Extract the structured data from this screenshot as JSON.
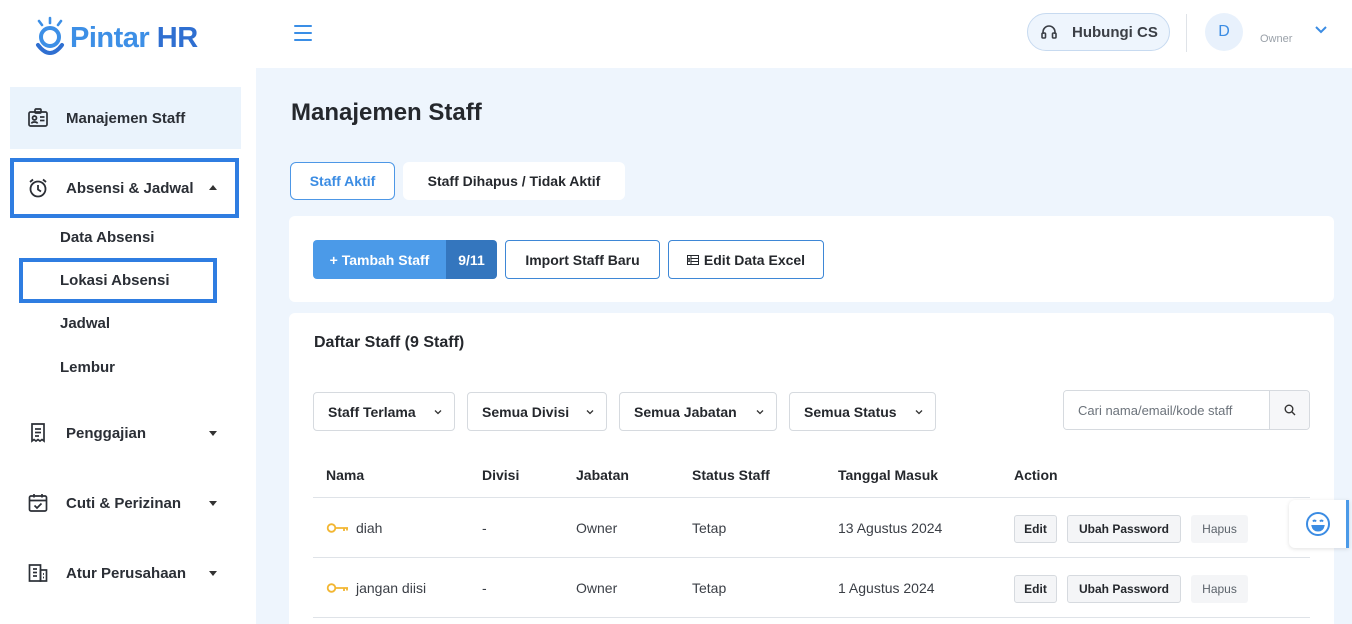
{
  "brand": {
    "logo_text": "Pintar",
    "logo_text_hr": "HR",
    "accent": "#3d8fe6"
  },
  "sidebar": {
    "items": [
      {
        "label": "Manajemen Staff",
        "icon": "id-card-icon"
      },
      {
        "label": "Absensi & Jadwal",
        "icon": "alarm-clock-icon"
      },
      {
        "label": "Penggajian",
        "icon": "receipt-icon"
      },
      {
        "label": "Cuti & Perizinan",
        "icon": "calendar-check-icon"
      },
      {
        "label": "Atur Perusahaan",
        "icon": "building-icon"
      }
    ],
    "submenu": [
      "Data Absensi",
      "Lokasi Absensi",
      "Jadwal",
      "Lembur"
    ]
  },
  "header": {
    "cs_label": "Hubungi CS",
    "avatar_initial": "D",
    "role": "Owner"
  },
  "main": {
    "title": "Manajemen Staff",
    "tabs": [
      "Staff Aktif",
      "Staff Dihapus / Tidak Aktif"
    ],
    "add_button": "+ Tambah Staff",
    "quota": "9/11",
    "import_button": "Import Staff Baru",
    "excel_button": "Edit Data Excel",
    "list_title": "Daftar Staff (9 Staff)",
    "filters": [
      "Staff Terlama",
      "Semua Divisi",
      "Semua Jabatan",
      "Semua Status"
    ],
    "search_placeholder": "Cari nama/email/kode staff",
    "columns": [
      "Nama",
      "Divisi",
      "Jabatan",
      "Status Staff",
      "Tanggal Masuk",
      "Action"
    ],
    "rows": [
      {
        "name": "diah",
        "divisi": "-",
        "jabatan": "Owner",
        "status": "Tetap",
        "tanggal": "13 Agustus 2024"
      },
      {
        "name": "jangan diisi",
        "divisi": "-",
        "jabatan": "Owner",
        "status": "Tetap",
        "tanggal": "1 Agustus 2024"
      }
    ],
    "actions": {
      "edit": "Edit",
      "password": "Ubah Password",
      "delete": "Hapus"
    }
  }
}
